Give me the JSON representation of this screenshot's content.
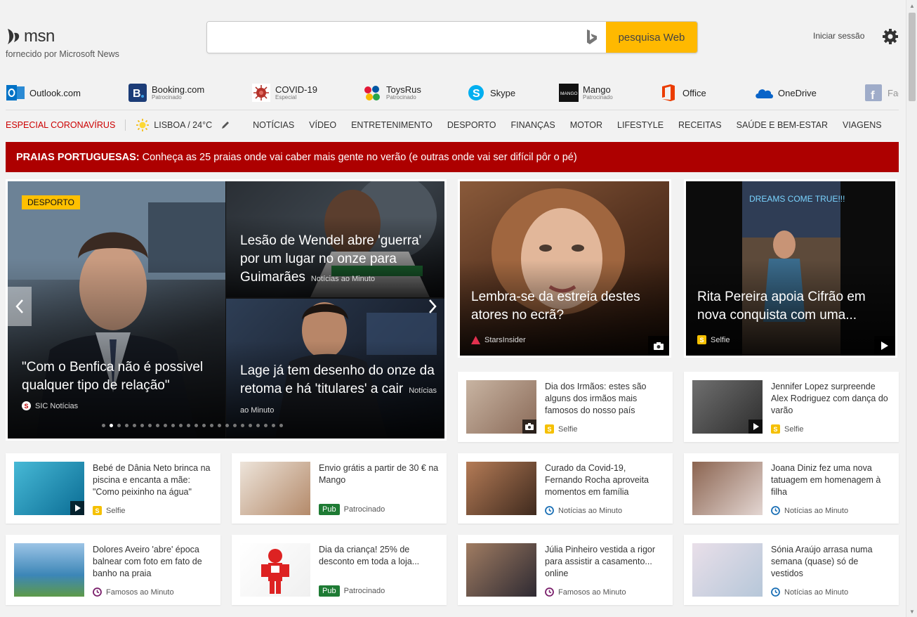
{
  "brand": {
    "name": "msn",
    "subtitle": "fornecido por Microsoft News"
  },
  "search": {
    "value": "",
    "placeholder": "",
    "button_label": "pesquisa Web"
  },
  "header": {
    "signin_label": "Iniciar sessão"
  },
  "quicklinks": [
    {
      "label": "Outlook.com",
      "sub": ""
    },
    {
      "label": "Booking.com",
      "sub": "Patrocinado"
    },
    {
      "label": "COVID-19",
      "sub": "Especial"
    },
    {
      "label": "ToysRus",
      "sub": "Patrocinado"
    },
    {
      "label": "Skype",
      "sub": ""
    },
    {
      "label": "Mango",
      "sub": "Patrocinado"
    },
    {
      "label": "Office",
      "sub": ""
    },
    {
      "label": "OneDrive",
      "sub": ""
    },
    {
      "label": "Fac",
      "sub": ""
    }
  ],
  "nav": {
    "special": "ESPECIAL CORONAVÍRUS",
    "weather": "LISBOA / 24°C",
    "items": [
      "NOTÍCIAS",
      "VÍDEO",
      "ENTRETENIMENTO",
      "DESPORTO",
      "FINANÇAS",
      "MOTOR",
      "LIFESTYLE",
      "RECEITAS",
      "SAÚDE E BEM-ESTAR",
      "VIAGENS"
    ]
  },
  "banner": {
    "bold": "PRAIAS PORTUGUESAS:",
    "text": "Conheça as 25 praias onde vai caber mais gente no verão (e outras onde vai ser difícil pôr o pé)"
  },
  "hero": {
    "badge": "DESPORTO",
    "main": {
      "title": "\"Com o Benfica não é possivel qualquer tipo de relação\"",
      "source": "SIC Notícias"
    },
    "top_right": {
      "title": "Lesão de Wendel abre 'guerra' por um lugar no onze para Guimarães",
      "source": "Notícias ao Minuto"
    },
    "bottom_right": {
      "title": "Lage já tem desenho do onze da retoma e há 'titulares' a cair",
      "source": "Notícias ao Minuto"
    },
    "dot_count": 24,
    "active_dot": 2
  },
  "tall_cards": [
    {
      "title": "Lembra-se da estreia destes atores no ecrã?",
      "source": "StarsInsider"
    },
    {
      "title": "Rita Pereira apoia Cifrão em nova conquista com uma...",
      "source": "Selfie",
      "overlay_text": "DREAMS COME TRUE!!!"
    }
  ],
  "cards": [
    {
      "text": "Dia dos Irmãos: estes são alguns dos irmãos mais famosos do nosso país",
      "source": "Selfie",
      "pub": ""
    },
    {
      "text": "Jennifer Lopez surpreende Alex Rodriguez com dança do varão",
      "source": "Selfie",
      "pub": ""
    },
    {
      "text": "Bebé de Dânia Neto brinca na piscina e encanta a mãe: \"Como peixinho na água\"",
      "source": "Selfie",
      "pub": ""
    },
    {
      "text": "Envio grátis a partir de 30 € na Mango",
      "source": "Patrocinado",
      "pub": "Pub"
    },
    {
      "text": "Curado da Covid-19, Fernando Rocha aproveita momentos em família",
      "source": "Notícias ao Minuto",
      "pub": ""
    },
    {
      "text": "Joana Diniz fez uma nova tatuagem em homenagem à filha",
      "source": "Notícias ao Minuto",
      "pub": ""
    },
    {
      "text": "Dolores Aveiro 'abre' época balnear com foto em fato de banho na praia",
      "source": "Famosos ao Minuto",
      "pub": ""
    },
    {
      "text": "Dia da criança! 25% de desconto em toda a loja...",
      "source": "Patrocinado",
      "pub": "Pub"
    },
    {
      "text": "Júlia Pinheiro vestida a rigor para assistir a casamento... online",
      "source": "Famosos ao Minuto",
      "pub": ""
    },
    {
      "text": "Sónia Araújo arrasa numa semana (quase) só de vestidos",
      "source": "Notícias ao Minuto",
      "pub": ""
    }
  ],
  "colors": {
    "accent": "#ffb900",
    "banner": "#ad0000",
    "special": "#cc0000",
    "pub": "#1e7b34",
    "badge": "#ffc000"
  }
}
